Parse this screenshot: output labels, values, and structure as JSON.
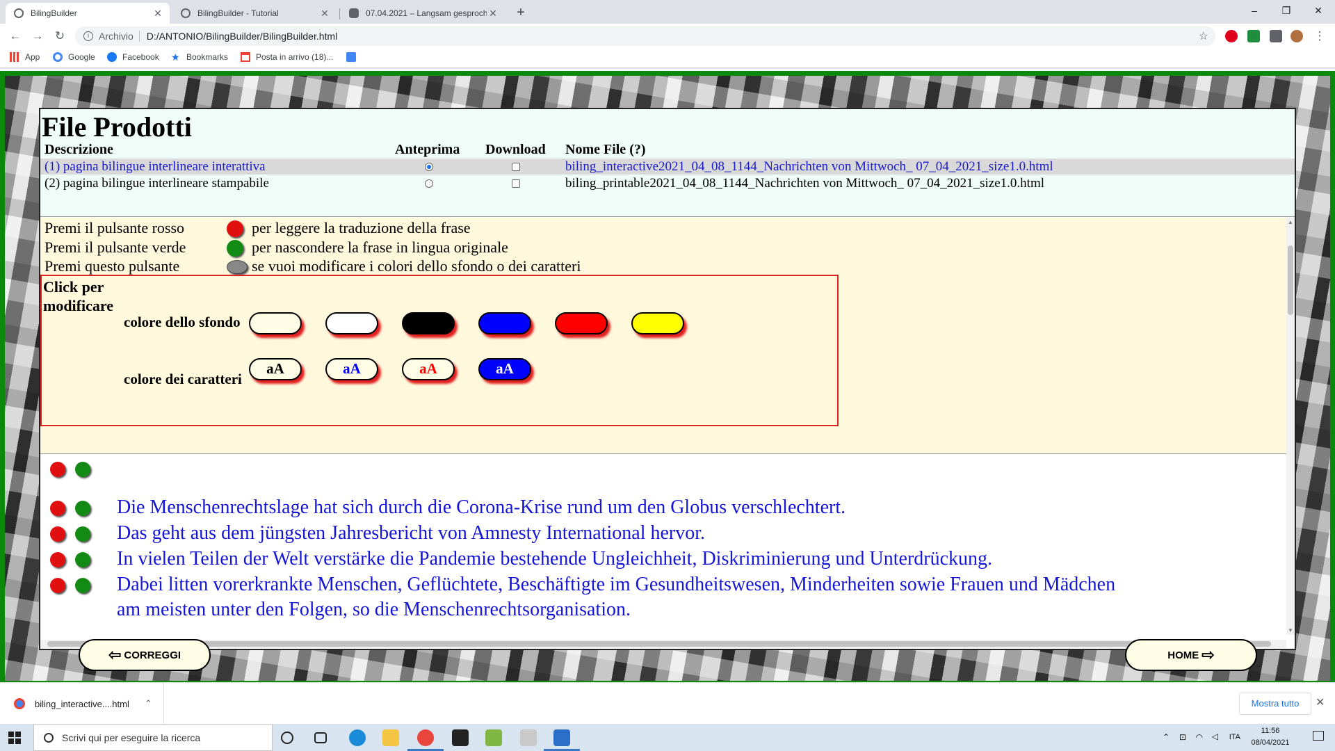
{
  "browser": {
    "tabs": [
      {
        "title": "BilingBuilder",
        "active": true
      },
      {
        "title": "BilingBuilder - Tutorial",
        "active": false
      },
      {
        "title": "07.04.2021 – Langsam gesproche",
        "active": false
      }
    ],
    "new_tab": "+",
    "window_controls": {
      "minimize": "–",
      "maximize": "❐",
      "close": "✕"
    },
    "nav": {
      "back": "←",
      "forward": "→",
      "reload": "↻"
    },
    "address": {
      "security_label": "Archivio",
      "url": "D:/ANTONIO/BilingBuilder/BilingBuilder.html"
    },
    "bookmarks": [
      "App",
      "Google",
      "Facebook",
      "Bookmarks",
      "Posta in arrivo (18)..."
    ]
  },
  "files": {
    "title": "File Prodotti",
    "headers": {
      "descrizione": "Descrizione",
      "anteprima": "Anteprima",
      "download": "Download",
      "nome_file": "Nome File (?)"
    },
    "rows": [
      {
        "desc": "(1) pagina bilingue interlineare interattiva",
        "filename": "biling_interactive2021_04_08_1144_Nachrichten von Mittwoch_ 07_04_2021_size1.0.html",
        "preview": true,
        "download": false
      },
      {
        "desc": "(2) pagina bilingue interlineare stampabile",
        "filename": "biling_printable2021_04_08_1144_Nachrichten von Mittwoch_ 07_04_2021_size1.0.html",
        "preview": false,
        "download": false
      }
    ]
  },
  "help": {
    "rows": [
      {
        "label": "Premi il pulsante rosso",
        "text": "per leggere la traduzione della frase",
        "color": "#e01010"
      },
      {
        "label": "Premi il pulsante verde",
        "text": "per nascondere la frase in lingua originale",
        "color": "#138a13"
      },
      {
        "label": "Premi questo pulsante",
        "text": "se vuoi modificare i colori dello sfondo o dei caratteri",
        "color": "#888888"
      }
    ],
    "box_title_1": "Click per",
    "box_title_2": "modificare",
    "bg_label": "colore dello sfondo",
    "fg_label": "colore dei caratteri",
    "bg_colors": [
      "#fffde6",
      "#ffffff",
      "#000000",
      "#0000ff",
      "#ff0000",
      "#ffff00"
    ],
    "fg_buttons": [
      {
        "text": "aA",
        "color": "#000000",
        "bg": "#fffde6"
      },
      {
        "text": "aA",
        "color": "#0000ff",
        "bg": "#fffde6"
      },
      {
        "text": "aA",
        "color": "#ff0000",
        "bg": "#fffde6"
      },
      {
        "text": "aA",
        "color": "#ffffff",
        "bg": "#0000ff"
      }
    ]
  },
  "sentences": [
    "Die Menschenrechtslage hat sich durch die Corona-Krise rund um den Globus verschlechtert.",
    "Das geht aus dem jüngsten Jahresbericht von Amnesty International hervor.",
    "In vielen Teilen der Welt verstärke die Pandemie bestehende Ungleichheit, Diskriminierung und Unterdrückung.",
    "Dabei litten vorerkrankte Menschen, Geflüchtete, Beschäftigte im Gesundheitswesen, Minderheiten sowie Frauen und Mädchen",
    "am meisten unter den Folgen, so die Menschenrechtsorganisation."
  ],
  "buttons": {
    "correggi": "CORREGGI",
    "home": "HOME"
  },
  "downloads": {
    "file": "biling_interactive....html",
    "show_all": "Mostra tutto"
  },
  "taskbar": {
    "search_placeholder": "Scrivi qui per eseguire la ricerca",
    "lang": "ITA",
    "time": "11:56",
    "date": "08/04/2021"
  }
}
